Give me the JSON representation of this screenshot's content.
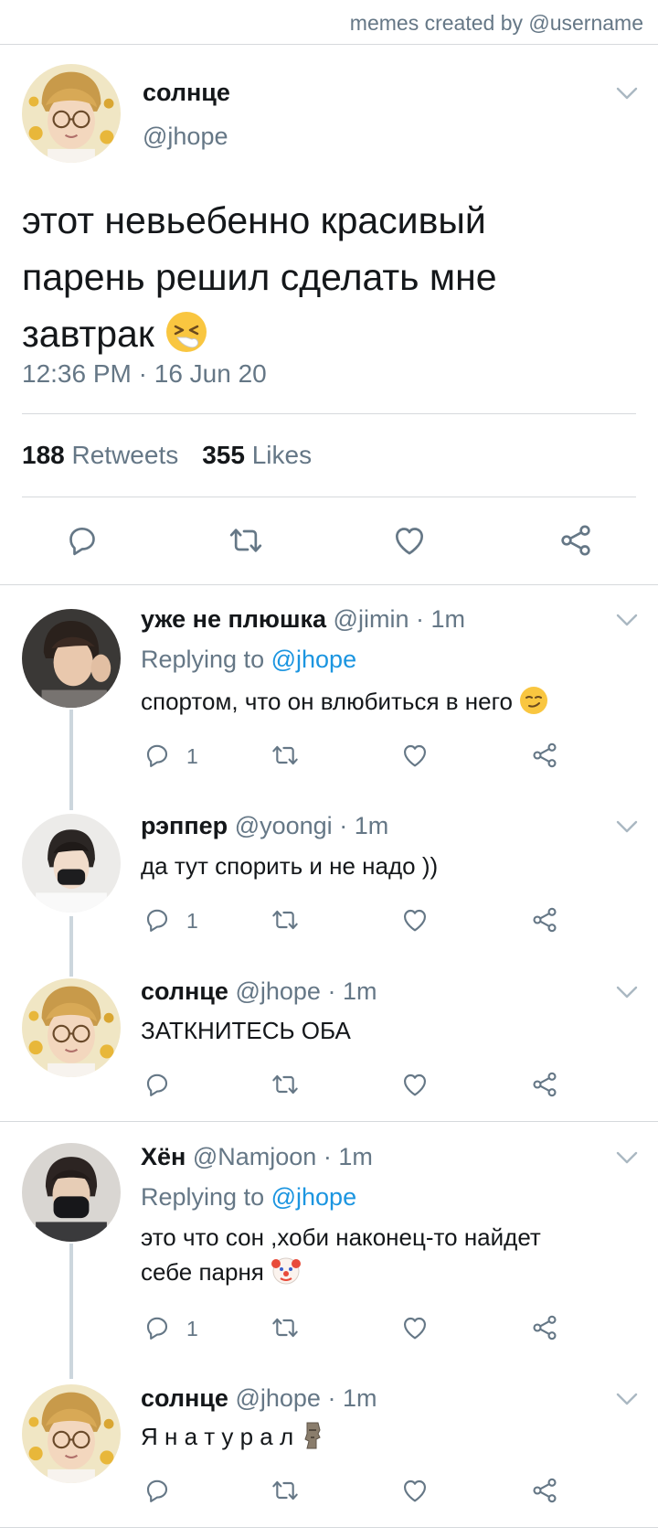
{
  "watermark": "memes created by @username",
  "tweet": {
    "name": "солнце",
    "handle": "@jhope",
    "text_lines": [
      "этот невьебенно красивый",
      "парень решил сделать мне",
      "завтрак"
    ],
    "text_emoji": "sneezing-face",
    "time": "12:36 PM",
    "date": "16 Jun 20",
    "retweets_count": "188",
    "retweets_label": "Retweets",
    "likes_count": "355",
    "likes_label": "Likes"
  },
  "replies": [
    {
      "name": "уже не плюшка",
      "handle": "@jimin",
      "sep": "·",
      "time": "1m",
      "replying_prefix": "Replying to",
      "replying_to": "@jhope",
      "text_lines": [
        "спортом, что он влюбиться в него"
      ],
      "emoji": "smirking-face",
      "reply_count": "1"
    },
    {
      "name": "рэппер",
      "handle": "@yoongi",
      "sep": "·",
      "time": "1m",
      "text_lines": [
        "да тут спорить и не надо ))"
      ],
      "reply_count": "1"
    },
    {
      "name": "солнце",
      "handle": "@jhope",
      "sep": "·",
      "time": "1m",
      "text_lines": [
        "ЗАТКНИТЕСЬ ОБА"
      ],
      "reply_count": ""
    },
    {
      "name": "Хён",
      "handle": "@Namjoon",
      "sep": "·",
      "time": "1m",
      "replying_prefix": "Replying to",
      "replying_to": "@jhope",
      "text_lines": [
        "это что сон ,хоби наконец-то найдет",
        "себе парня"
      ],
      "emoji": "clown-face",
      "reply_count": "1"
    },
    {
      "name": "солнце",
      "handle": "@jhope",
      "sep": "·",
      "time": "1m",
      "text_lines": [
        "Я н а т у р а л"
      ],
      "emoji": "moai",
      "reply_count": ""
    }
  ],
  "icons": {
    "reply": "reply-bubble-icon",
    "retweet": "retweet-icon",
    "like": "heart-icon",
    "share": "share-icon",
    "more": "chevron-down-icon"
  },
  "colors": {
    "text": "#14171a",
    "muted": "#657786",
    "link": "#1b95e0",
    "divider": "#d6d9dc"
  }
}
